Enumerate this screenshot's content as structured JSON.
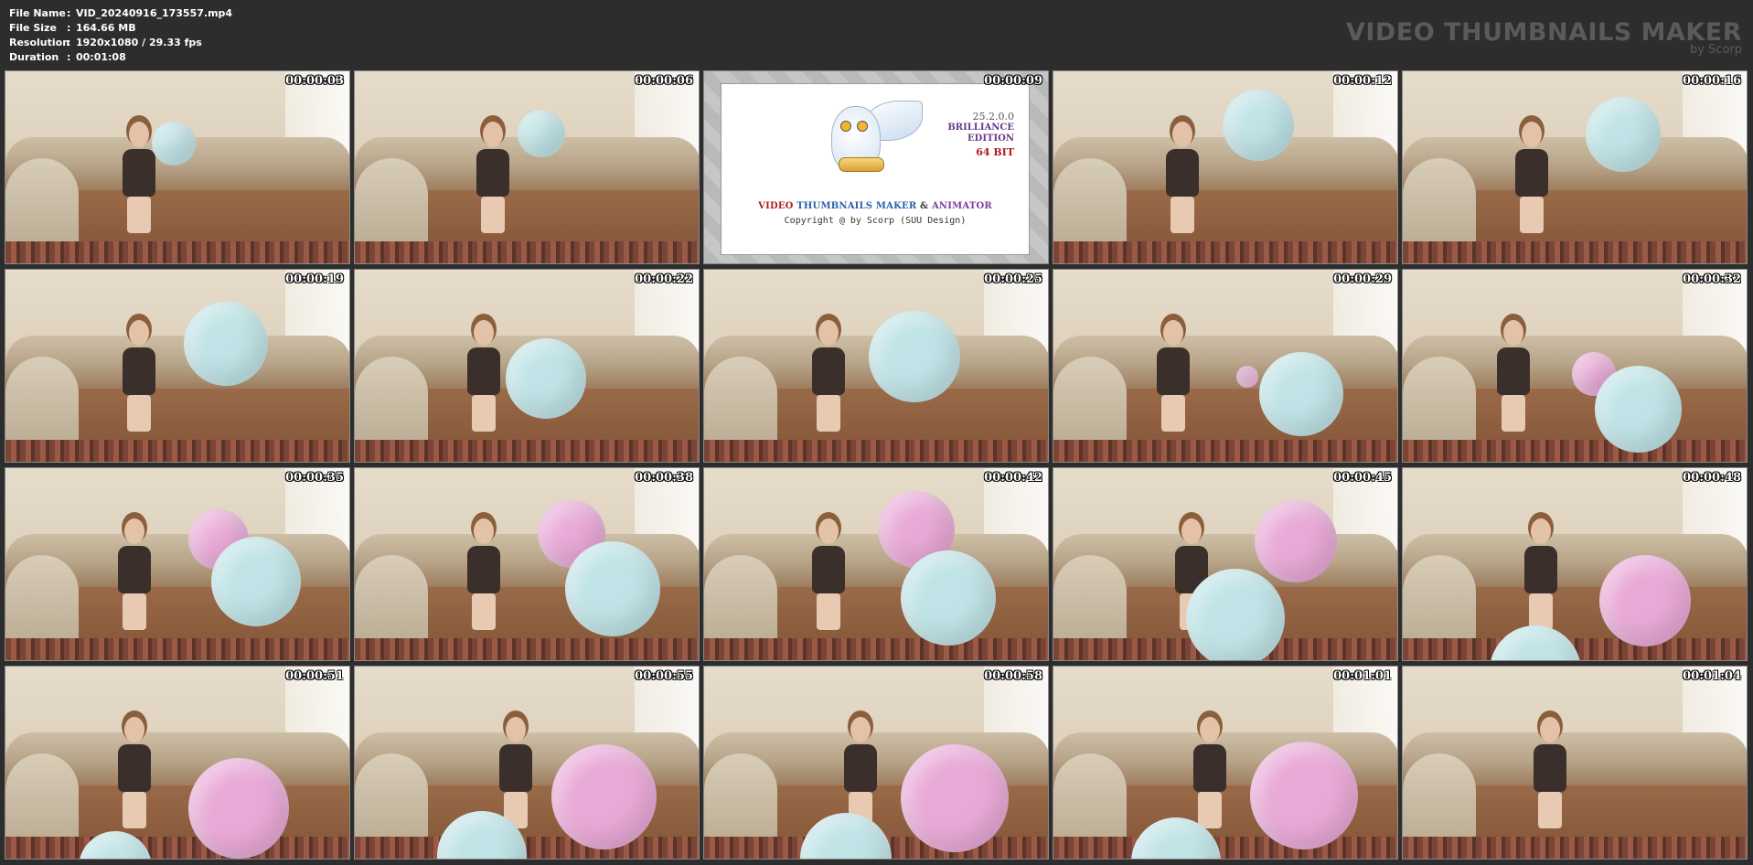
{
  "info": {
    "file_name_label": "File Name",
    "file_name_value": "VID_20240916_173557.mp4",
    "file_size_label": "File Size",
    "file_size_value": "164.66 MB",
    "resolution_label": "Resolution",
    "resolution_value": "1920x1080 / 29.33 fps",
    "duration_label": "Duration",
    "duration_value": "00:01:08",
    "separator": ":"
  },
  "brand": {
    "title": "VIDEO THUMBNAILS MAKER",
    "subtitle": "by Scorp"
  },
  "logo": {
    "version": "25.2.0.0",
    "edition_line1": "BRILLIANCE",
    "edition_line2": "EDITION",
    "bits": "64 BIT",
    "title_part1": "VIDEO",
    "title_part2": "THUMBNAILS MAKER",
    "title_amp": "&",
    "title_part3": "ANIMATOR",
    "copyright": "Copyright @ by Scorp (SUU Design)"
  },
  "colors": {
    "background": "#2d2d2d",
    "balloon_blue": "#bfe3e6",
    "balloon_pink": "#e8a9d6"
  },
  "thumbnails": [
    {
      "time": "00:00:03"
    },
    {
      "time": "00:00:06"
    },
    {
      "time": "00:00:09"
    },
    {
      "time": "00:00:12"
    },
    {
      "time": "00:00:16"
    },
    {
      "time": "00:00:19"
    },
    {
      "time": "00:00:22"
    },
    {
      "time": "00:00:25"
    },
    {
      "time": "00:00:29"
    },
    {
      "time": "00:00:32"
    },
    {
      "time": "00:00:35"
    },
    {
      "time": "00:00:38"
    },
    {
      "time": "00:00:42"
    },
    {
      "time": "00:00:45"
    },
    {
      "time": "00:00:48"
    },
    {
      "time": "00:00:51"
    },
    {
      "time": "00:00:55"
    },
    {
      "time": "00:00:58"
    },
    {
      "time": "00:01:01"
    },
    {
      "time": "00:01:04"
    }
  ]
}
